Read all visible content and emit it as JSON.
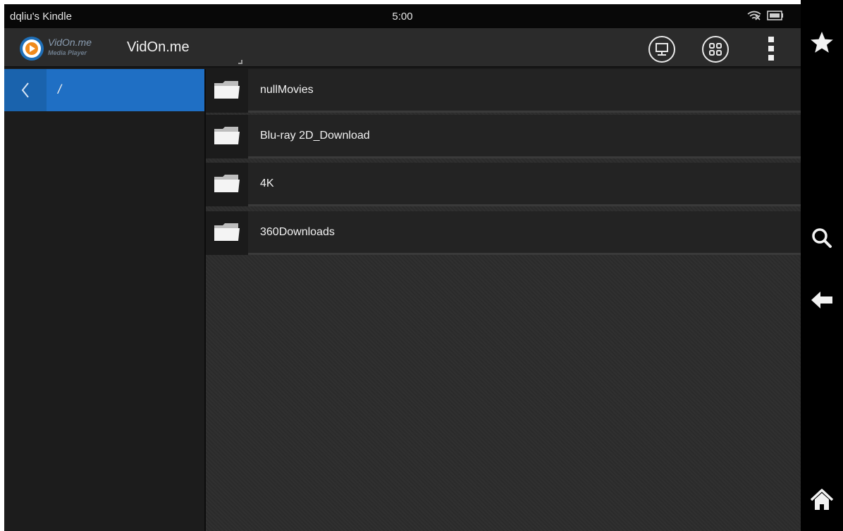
{
  "status_bar": {
    "device_name": "dqliu's Kindle",
    "time": "5:00",
    "icons": [
      "wifi-off-icon",
      "battery-icon"
    ]
  },
  "action_bar": {
    "logo": {
      "name": "VidOn.me",
      "subtitle": "Media Player",
      "icon": "vidon-logo-icon"
    },
    "title": "VidOn.me",
    "buttons": [
      {
        "icon": "remote-desktop-icon"
      },
      {
        "icon": "grid-view-icon"
      },
      {
        "icon": "overflow-menu-icon"
      }
    ]
  },
  "left_panel": {
    "back_icon": "chevron-left-icon",
    "path": "/",
    "accent_color": "#1f6fc4"
  },
  "file_list": {
    "items": [
      {
        "name": "nullMovies",
        "icon": "folder-icon"
      },
      {
        "name": "Blu-ray 2D_Download",
        "icon": "folder-icon"
      },
      {
        "name": "4K",
        "icon": "folder-icon"
      },
      {
        "name": "360Downloads",
        "icon": "folder-icon"
      }
    ]
  },
  "system_bar": {
    "buttons": [
      "star-icon",
      "search-icon",
      "back-arrow-icon",
      "home-icon"
    ]
  }
}
